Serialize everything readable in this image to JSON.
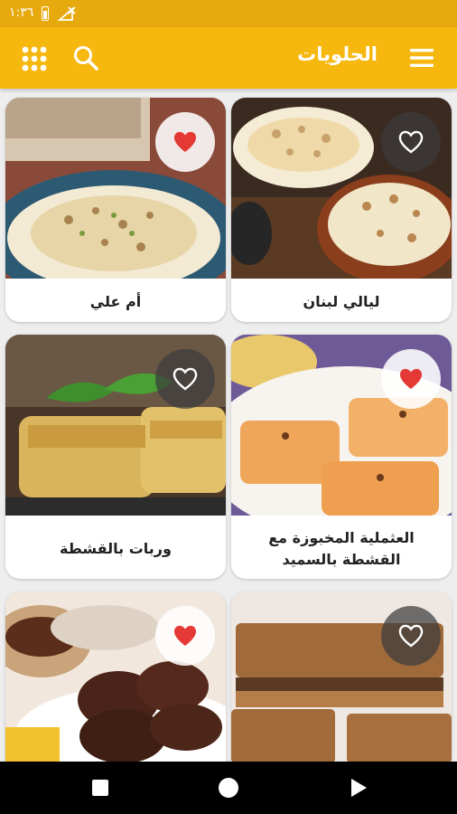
{
  "status_bar": {
    "time": "١:٣٦"
  },
  "app_bar": {
    "title": "الحلويات",
    "icons": [
      "grid-icon",
      "search-icon",
      "menu-icon"
    ]
  },
  "colors": {
    "status_bar": "#e6a90e",
    "app_bar": "#f6b70f",
    "favorite_on": "#e53935",
    "favorite_off": "#ffffff"
  },
  "recipes": [
    {
      "title": "ليالي لبنان",
      "favorite": false
    },
    {
      "title": "أم علي",
      "favorite": true
    },
    {
      "title": "العثملية المخبوزة مع القشطة بالسميد",
      "favorite": true
    },
    {
      "title": "وربات بالقشطة",
      "favorite": false
    },
    {
      "title": "",
      "favorite": false
    },
    {
      "title": "",
      "favorite": true
    }
  ],
  "nav_bar": {
    "icons": [
      "recents-icon",
      "home-icon",
      "back-icon"
    ]
  }
}
